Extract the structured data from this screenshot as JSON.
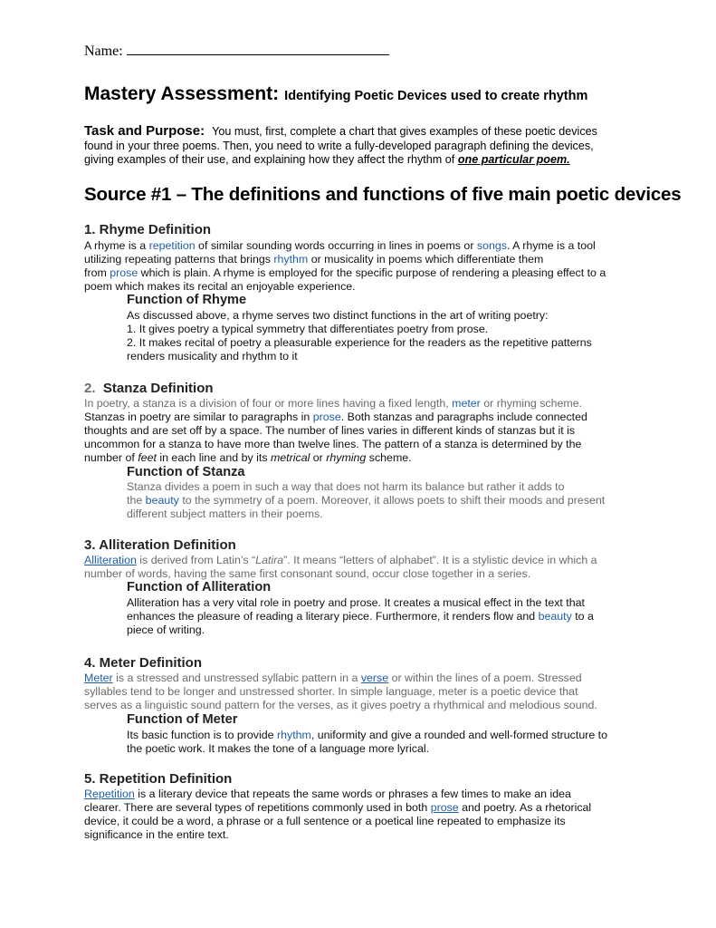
{
  "header": {
    "name_label": "Name:",
    "title": "Mastery Assessment:",
    "subtitle": "Identifying Poetic Devices used to create rhythm"
  },
  "task": {
    "label": "Task and Purpose:",
    "line1": "You must, first, complete a chart that gives examples of these poetic devices",
    "line2": "found in your three poems.  Then, you need to write a fully-developed paragraph defining the devices,",
    "line3": "giving examples of their use, and explaining how they affect the rhythm of ",
    "emphasis": "one particular poem."
  },
  "source_heading": "Source #1 – The definitions and functions of five main poetic devices",
  "sections": {
    "rhyme": {
      "heading": "1. Rhyme Definition",
      "def": {
        "l1a": "A rhyme is a ",
        "l1b": "repetition",
        "l1c": " of similar sounding words occurring in lines in poems or ",
        "l1d": "songs",
        "l1e": ".  A rhyme is a tool",
        "l2a": "utilizing repeating patterns that brings ",
        "l2b": "rhythm",
        "l2c": " or musicality in poems which differentiate them",
        "l3a": "from ",
        "l3b": "prose",
        "l3c": " which is plain. A rhyme is employed for the specific purpose of rendering a pleasing effect to a",
        "l4": "poem which makes its recital an enjoyable experience."
      },
      "function_heading": "Function of Rhyme",
      "function": {
        "l1": "As discussed above, a rhyme serves two distinct functions in the art of writing poetry:",
        "l2": "1. It gives poetry a typical symmetry that differentiates poetry from prose.",
        "l3": "2. It makes recital of poetry a pleasurable experience for the readers as the repetitive patterns",
        "l4": "renders musicality and rhythm to it"
      }
    },
    "stanza": {
      "heading_num": "2.",
      "heading": "Stanza Definition",
      "def": {
        "l1a": "In poetry, a stanza is a division of four or more lines having a fixed length, ",
        "l1b": "meter",
        "l1c": " or rhyming scheme.",
        "l2a": "Stanzas in poetry are similar to paragraphs in ",
        "l2b": "prose",
        "l2c": ". Both stanzas and paragraphs include connected",
        "l3": "thoughts and are set off by a space. The number of lines varies in different kinds of stanzas but it is",
        "l4": "uncommon for a stanza to have more than twelve lines. The pattern of a stanza is determined by the",
        "l5a": "number of ",
        "l5b": "feet",
        "l5c": " in each line and by its ",
        "l5d": "metrical",
        "l5e": " or ",
        "l5f": "rhyming",
        "l5g": " scheme."
      },
      "function_heading": "Function of Stanza",
      "function": {
        "l1": "Stanza divides a poem in such a way that does not harm its balance but rather it  adds to",
        "l2a": "the ",
        "l2b": "beauty",
        "l2c": " to the symmetry of a poem. Moreover, it allows poets to shift   their moods and present",
        "l3": "different subject matters in their poems."
      }
    },
    "alliteration": {
      "heading": "3.   Alliteration Definition",
      "def": {
        "l1a": "Alliteration",
        "l1b": " is derived from Latin’s “",
        "l1c": "Latira",
        "l1d": "”. It means “letters of alphabet”. It is a stylistic device in which a",
        "l2": "number of words, having the same first consonant sound, occur close together in a series."
      },
      "function_heading": "Function of Alliteration",
      "function": {
        "l1": "Alliteration has a very vital role in poetry and prose. It creates a musical effect in   the text that",
        "l2a": "enhances the pleasure of reading a literary piece. Furthermore, it renders flow and ",
        "l2b": "beauty",
        "l2c": " to a",
        "l3": "piece of writing."
      }
    },
    "meter": {
      "heading": "4.  Meter Definition",
      "def": {
        "l1a": "Meter",
        "l1b": " is a stressed and unstressed syllabic pattern in a ",
        "l1c": "verse",
        "l1d": " or within the lines of a poem. Stressed",
        "l2": "syllables tend to be longer and unstressed shorter. In simple language, meter is a poetic device that",
        "l3": "serves as a linguistic sound pattern for the verses, as it gives poetry a rhythmical and melodious sound."
      },
      "function_heading": "Function of Meter",
      "function": {
        "l1a": "Its basic function is to provide ",
        "l1b": "rhythm",
        "l1c": ", uniformity and give a rounded and well-formed structure to",
        "l2": "the poetic work. It makes the tone of a language more lyrical."
      }
    },
    "repetition": {
      "heading": "5.  Repetition Definition",
      "def": {
        "l1a": "Repetition",
        "l1b": " is a literary device that repeats the same words or phrases a few times to make an idea",
        "l2a": "clearer. There are several types of repetitions commonly used in both ",
        "l2b": "prose",
        "l2c": " and poetry. As a rhetorical",
        "l3": "device, it could be a word, a phrase or a full sentence or a poetical line repeated to emphasize its",
        "l4": "significance in the entire text."
      }
    }
  },
  "colors": {
    "link": "#1f5fa8",
    "gray_text": "#6b6b6b",
    "heading": "#222222"
  }
}
